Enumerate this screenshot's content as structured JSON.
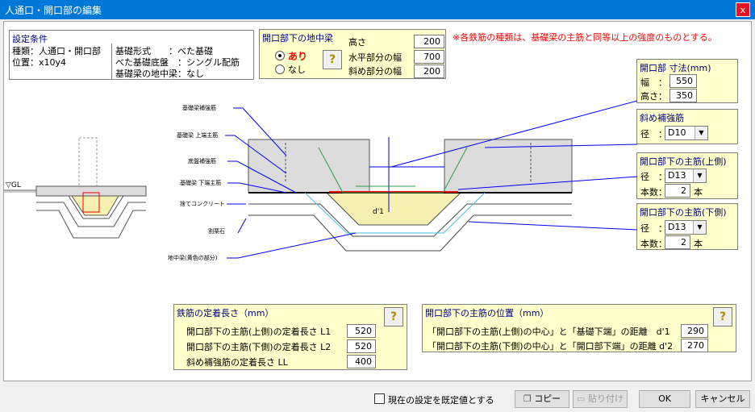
{
  "window": {
    "title": "人通口・開口部の編集",
    "close": "x"
  },
  "conditions": {
    "title": "設定条件",
    "type": "種類：人通口・開口部",
    "position": "位置：x10y4",
    "foundation": "基礎形式　　：べた基礎",
    "slab": "べた基礎底盤　：シングル配筋",
    "beam": "基礎梁の地中梁：なし"
  },
  "ground_beam": {
    "title": "開口部下の地中梁",
    "option_yes": "あり",
    "option_no": "なし",
    "height_label": "高さ",
    "height": "200",
    "horizontal_label": "水平部分の幅",
    "horizontal": "700",
    "slope_label": "斜め部分の幅",
    "slope": "200"
  },
  "note": "※各鉄筋の種類は、基礎梁の主筋と同等以上の強度のものとする。",
  "opening": {
    "title": "開口部 寸法(mm)",
    "width_label": "幅　：",
    "width": "550",
    "height_label": "高さ：",
    "height": "350"
  },
  "diagonal": {
    "title": "斜め補強筋",
    "dia_label": "径　：",
    "dia": "D10"
  },
  "upper_bar": {
    "title": "開口部下の主筋(上側)",
    "dia_label": "径　：",
    "dia": "D13",
    "count_label": "本数：",
    "count": "2",
    "unit": "本"
  },
  "lower_bar": {
    "title": "開口部下の主筋(下側)",
    "dia_label": "径　：",
    "dia": "D13",
    "count_label": "本数：",
    "count": "2",
    "unit": "本"
  },
  "diagram": {
    "gl": "▽GL",
    "l1": "基礎梁補強筋",
    "l2": "基礎梁 上端主筋",
    "l3": "底盤補強筋",
    "l4": "基礎梁 下端主筋",
    "l5": "捨てコンクリート",
    "l6": "割栗石",
    "l7": "地中梁(黄色の部分)",
    "d1": "d'1"
  },
  "anchorage": {
    "title": "鉄筋の定着長さ（mm）",
    "l1_label": "開口部下の主筋(上側)の定着長さ L1",
    "l1": "520",
    "l2_label": "開口部下の主筋(下側)の定着長さ L2",
    "l2": "520",
    "ll_label": "斜め補強筋の定着長さ LL",
    "ll": "400"
  },
  "position": {
    "title": "開口部下の主筋の位置（mm）",
    "d1_label": "「開口部下の主筋(上側)の中心」と「基礎下端」の距離　d'1",
    "d1": "290",
    "d2_label": "「開口部下の主筋(下側)の中心」と「開口部下端」の距離 d'2",
    "d2": "270"
  },
  "footer": {
    "default_label": "現在の設定を既定値とする",
    "copy": "コピー",
    "paste": "貼り付け",
    "ok": "OK",
    "cancel": "キャンセル"
  }
}
